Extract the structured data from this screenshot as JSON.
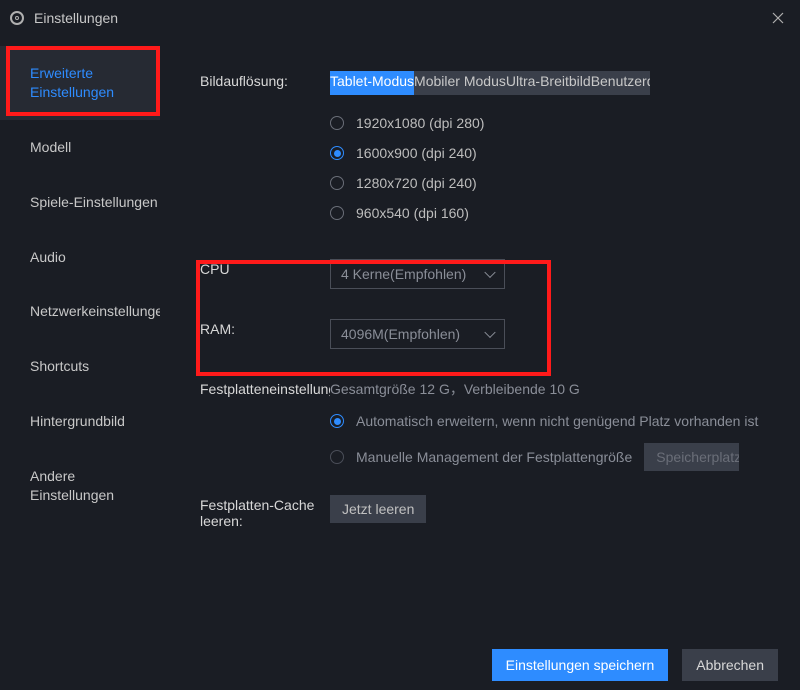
{
  "window": {
    "title": "Einstellungen"
  },
  "sidebar": {
    "items": [
      {
        "label": "Erweiterte Einstellungen",
        "active": true
      },
      {
        "label": "Modell",
        "active": false
      },
      {
        "label": "Spiele-Einstellungen",
        "active": false
      },
      {
        "label": "Audio",
        "active": false
      },
      {
        "label": "Netzwerkeinstellungen",
        "active": false
      },
      {
        "label": "Shortcuts",
        "active": false
      },
      {
        "label": "Hintergrundbild",
        "active": false
      },
      {
        "label": "Andere Einstellungen",
        "active": false
      }
    ]
  },
  "resolution": {
    "label": "Bildauflösung:",
    "modes": [
      {
        "label": "Tablet-Modus",
        "active": true
      },
      {
        "label": "Mobiler Modus",
        "active": false
      },
      {
        "label": "Ultra-Breitbild",
        "active": false
      },
      {
        "label": "Benutzerdefiniert",
        "active": false
      }
    ],
    "options": [
      {
        "label": "1920x1080  (dpi 280)",
        "checked": false
      },
      {
        "label": "1600x900  (dpi 240)",
        "checked": true
      },
      {
        "label": "1280x720  (dpi 240)",
        "checked": false
      },
      {
        "label": "960x540  (dpi 160)",
        "checked": false
      }
    ]
  },
  "cpu": {
    "label": "CPU",
    "value": "4 Kerne(Empfohlen)"
  },
  "ram": {
    "label": "RAM:",
    "value": "4096M(Empfohlen)"
  },
  "disk": {
    "label": "Festplatteneinstellungen:",
    "info": "Gesamtgröße 12 G，Verbleibende 10 G",
    "options": [
      {
        "label": "Automatisch erweitern, wenn nicht genügend Platz vorhanden ist",
        "checked": true
      },
      {
        "label": "Manuelle Management der Festplattengröße",
        "checked": false
      }
    ],
    "manual_button": "Speicherplatz erweitern"
  },
  "cache": {
    "label": "Festplatten-Cache leeren:",
    "button": "Jetzt leeren"
  },
  "footer": {
    "save": "Einstellungen speichern",
    "cancel": "Abbrechen"
  }
}
